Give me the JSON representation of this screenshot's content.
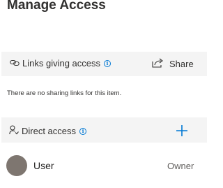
{
  "header": {
    "title": "Manage Access"
  },
  "links_section": {
    "label": "Links giving access",
    "info_icon": "info-icon",
    "share_label": "Share",
    "share_icon": "share-icon",
    "empty_message": "There are no sharing links for this item."
  },
  "direct_section": {
    "label": "Direct access",
    "info_icon": "info-icon",
    "add_icon": "plus-icon"
  },
  "members": [
    {
      "name": "User",
      "role": "Owner",
      "avatar_color": "#7e7670"
    }
  ],
  "colors": {
    "accent": "#0078d4",
    "section_bg": "#f4f4f4"
  }
}
